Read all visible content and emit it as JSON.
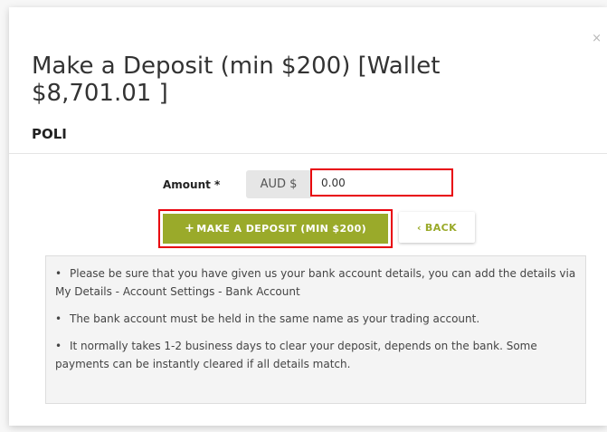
{
  "modal": {
    "close_label": "×",
    "title": "Make a Deposit (min $200) [Wallet $8,701.01 ]",
    "subtitle": "POLI"
  },
  "form": {
    "amount_label": "Amount *",
    "currency_addon": "AUD $",
    "amount_value": "0.00"
  },
  "actions": {
    "deposit_icon": "+",
    "deposit_label": "MAKE A DEPOSIT (MIN $200)",
    "back_icon": "‹",
    "back_label": "BACK"
  },
  "info": {
    "bullet": "•",
    "items": [
      "Please be sure that you have given us your bank account details, you can add the details via My Details - Account Settings - Bank Account",
      "The bank account must be held in the same name as your trading account.",
      "It normally takes 1-2 business days to clear your deposit, depends on the bank. Some payments can be instantly cleared if all details match."
    ]
  },
  "colors": {
    "accent": "#9aaa2a",
    "highlight": "#e8000b"
  },
  "icons": {
    "close": "close-icon",
    "plus": "plus-icon",
    "back": "chevron-left-icon"
  }
}
